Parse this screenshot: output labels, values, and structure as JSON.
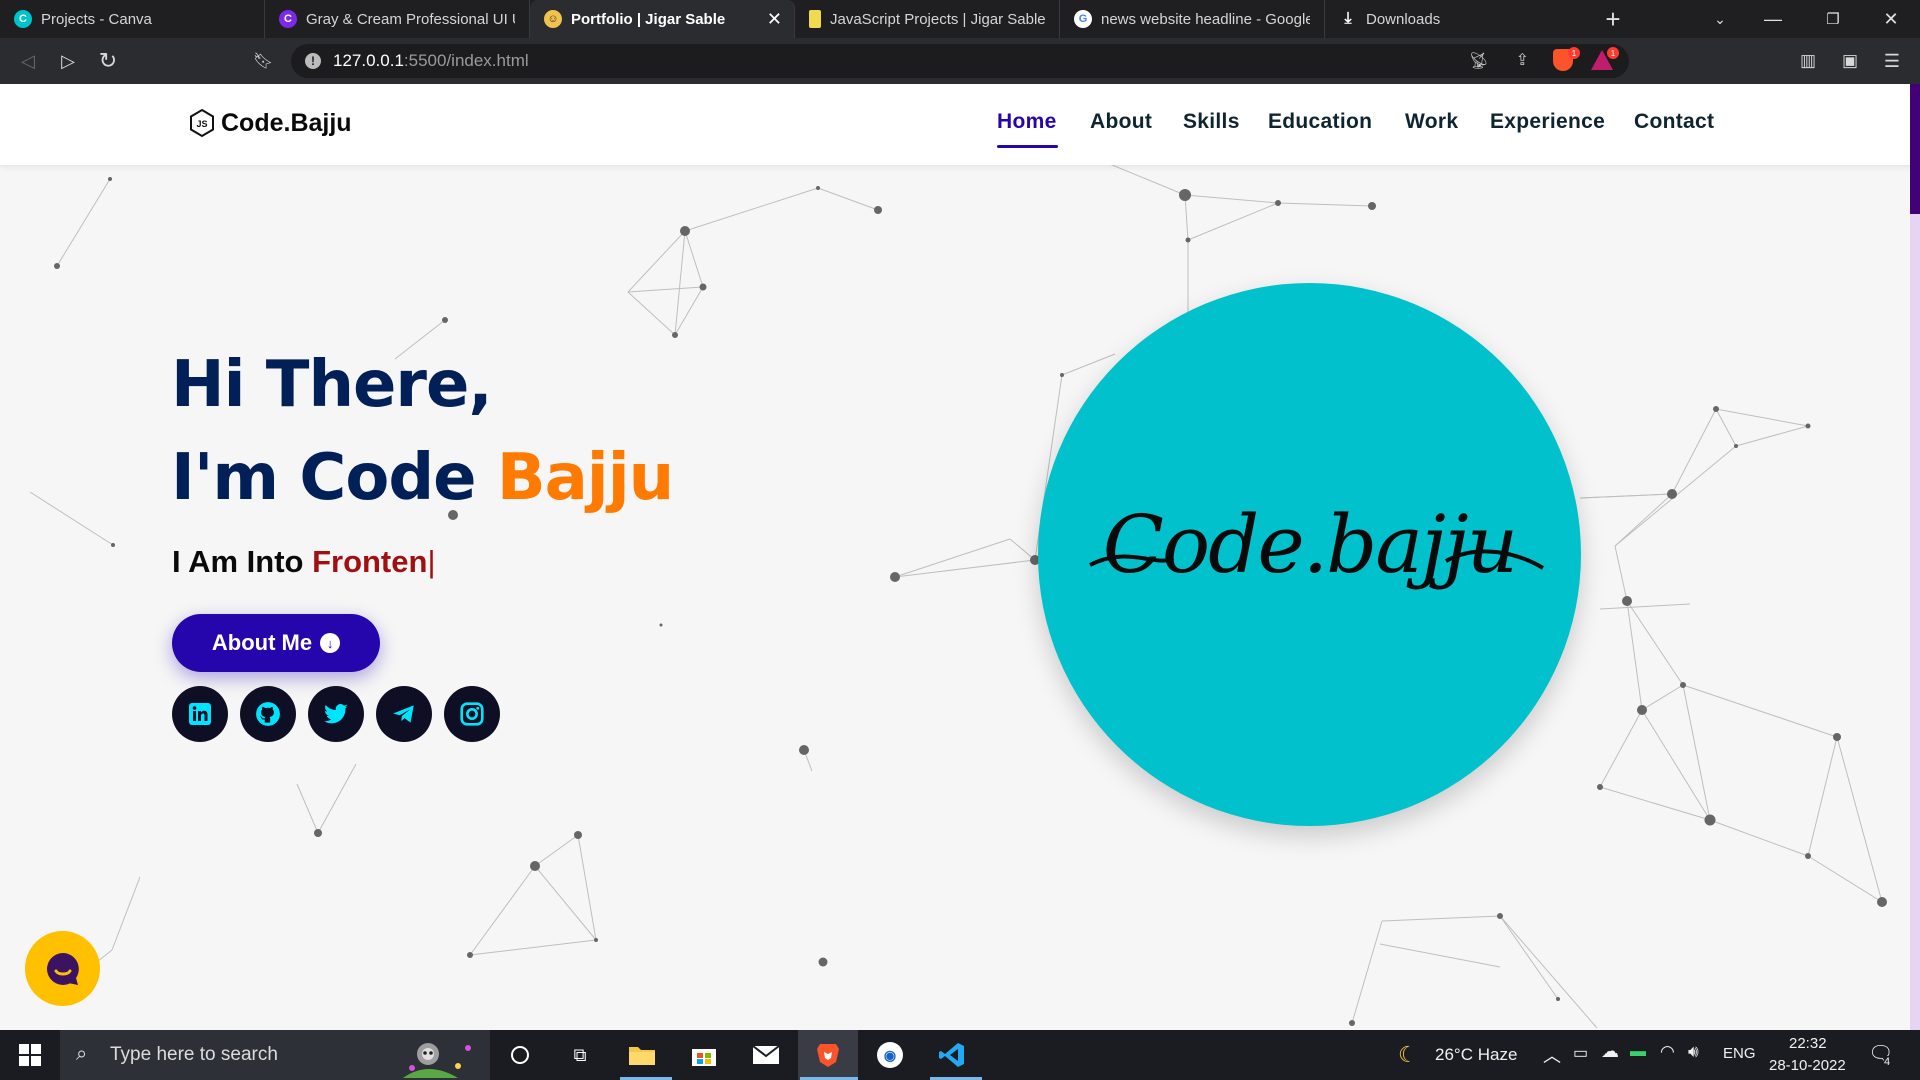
{
  "browser": {
    "tabs": [
      {
        "label": "Projects - Canva"
      },
      {
        "label": "Gray & Cream Professional UI UX"
      },
      {
        "label": "Portfolio | Jigar Sable"
      },
      {
        "label": "JavaScript Projects | Jigar Sable"
      },
      {
        "label": "news website headline - Google"
      },
      {
        "label": "Downloads"
      }
    ],
    "url_host": "127.0.0.1",
    "url_path": ":5500/index.html",
    "brave_badge": "1",
    "rewards_badge": "1"
  },
  "page": {
    "brand": "Code.Bajju",
    "nav": [
      "Home",
      "About",
      "Skills",
      "Education",
      "Work",
      "Experience",
      "Contact"
    ],
    "hero_line1": "Hi There,",
    "hero_line2_prefix": "I'm Code ",
    "hero_line2_accent": "Bajju",
    "typing_prefix": "I Am Into ",
    "typing_value": "Fronten",
    "typing_caret": "|",
    "about_button": "About Me",
    "social": [
      "linkedin-icon",
      "github-icon",
      "twitter-icon",
      "telegram-icon",
      "instagram-icon"
    ],
    "avatar_signature": "Code.bajju",
    "colors": {
      "primary": "#2506ad",
      "accent": "#ff7a00",
      "heading": "#002057",
      "avatar_bg": "#00c1cc",
      "typed": "#a01010"
    }
  },
  "taskbar": {
    "search_placeholder": "Type here to search",
    "weather": "26°C  Haze",
    "lang": "ENG",
    "time": "22:32",
    "date": "28-10-2022",
    "notifications": "4"
  }
}
